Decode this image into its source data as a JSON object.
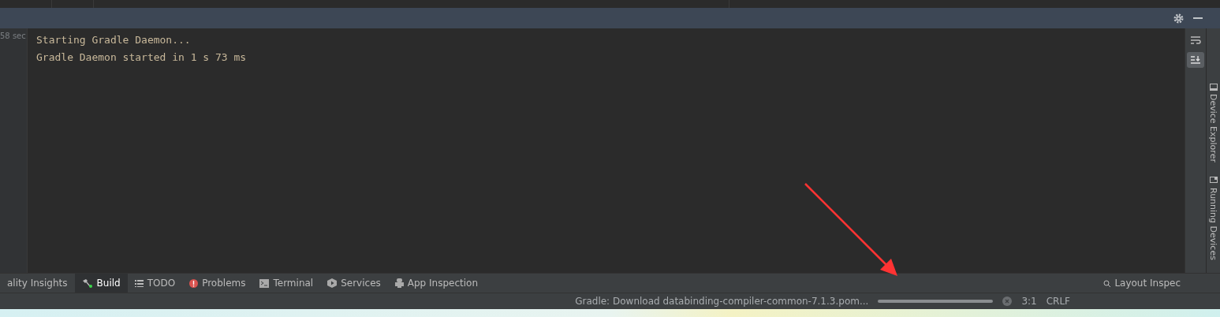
{
  "header": {
    "actions": [
      {
        "kind": "settings"
      },
      {
        "kind": "minimize"
      }
    ]
  },
  "gutter": {
    "time": "58 sec"
  },
  "console": {
    "lines": [
      "Starting Gradle Daemon...",
      "Gradle Daemon started in 1 s 73 ms"
    ]
  },
  "console_toolbar": [
    {
      "kind": "wrap",
      "selected": false
    },
    {
      "kind": "scroll",
      "selected": true
    }
  ],
  "right_stripe": [
    {
      "label": "Device Explorer",
      "kind": "device"
    },
    {
      "label": "Running Devices",
      "kind": "running"
    }
  ],
  "tool_tabs": [
    {
      "label": "ality Insights",
      "kind": "none",
      "selected": false
    },
    {
      "label": "Build",
      "kind": "build",
      "selected": true
    },
    {
      "label": "TODO",
      "kind": "todo",
      "selected": false
    },
    {
      "label": "Problems",
      "kind": "problems",
      "selected": false
    },
    {
      "label": "Terminal",
      "kind": "terminal",
      "selected": false
    },
    {
      "label": "Services",
      "kind": "services",
      "selected": false
    },
    {
      "label": "App Inspection",
      "kind": "inspection",
      "selected": false
    }
  ],
  "right_tab": {
    "label": "Layout Inspec"
  },
  "status_bar": {
    "task": "Gradle: Download databinding-compiler-common-7.1.3.pom...",
    "position": "3:1",
    "line_separator": "CRLF"
  }
}
